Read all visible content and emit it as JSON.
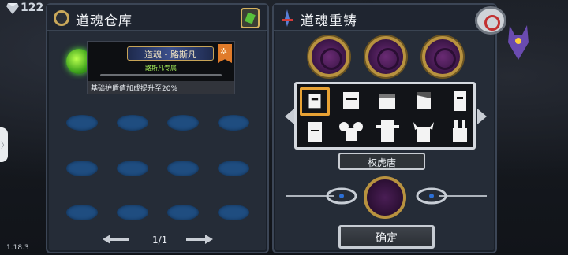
{
  "hud": {
    "currency": "122",
    "version": "1.18.3",
    "side_tab_glyph": "〉"
  },
  "left_panel": {
    "title": "道魂仓库",
    "icons": {
      "header_left": "ring-icon",
      "header_right": "map-icon"
    },
    "tooltip": {
      "name": "道魂・路斯凡",
      "badge": "✲",
      "subtitle": "路斯凡专属",
      "description": "基础护盾值加成提升至20%"
    },
    "pager": {
      "text": "1/1",
      "prev": "left-arrow-icon",
      "next": "right-arrow-icon"
    }
  },
  "right_panel": {
    "title": "道魂重铸",
    "selected_name": "权虎唐",
    "confirm_label": "确定",
    "portraits": [
      "knight",
      "rogue",
      "bandana",
      "elf",
      "paladin",
      "priest",
      "mouse",
      "cowboy",
      "viking",
      "rabbit"
    ],
    "selected_index": 0
  },
  "colors": {
    "panel": "#252c37",
    "slot": "#1f4d80",
    "gold": "#b8923f",
    "select": "#e8a234"
  }
}
